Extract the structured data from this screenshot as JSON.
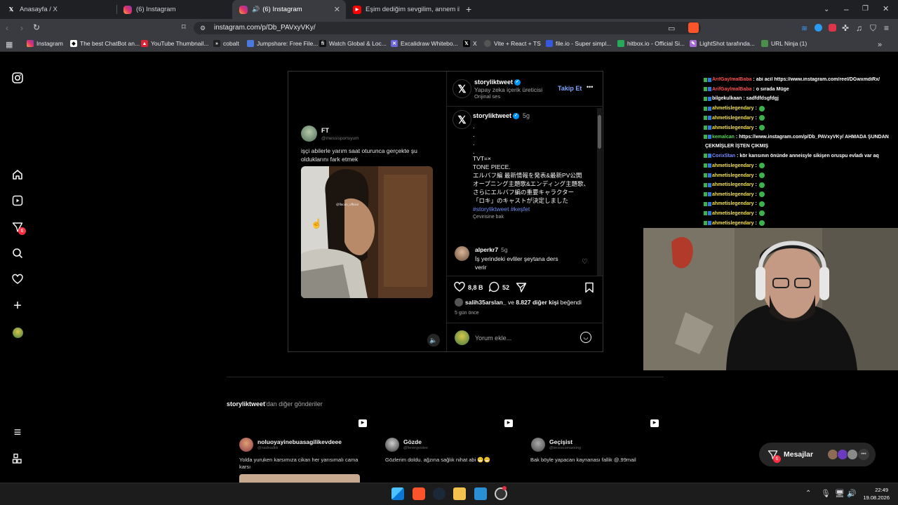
{
  "browser": {
    "tabs": [
      {
        "title": "Anasayfa / X",
        "icon": "x-logo-icon",
        "active": false
      },
      {
        "title": "(6) Instagram",
        "icon": "instagram-icon",
        "active": false
      },
      {
        "title": "(6) Instagram",
        "icon": "instagram-icon",
        "active": true
      },
      {
        "title": "Eşim dediğim sevgilim, annem ile ka...",
        "icon": "youtube-icon",
        "active": false
      }
    ],
    "url": "instagram.com/p/Db_PAVxyVKy/",
    "bookmarks": [
      "Instagram",
      "The best ChatBot an...",
      "YouTube Thumbnail...",
      "cobalt",
      "Jumpshare: Free File...",
      "Watch Global & Loc...",
      "Excalidraw Whitebo...",
      "X",
      "Vite + React + TS",
      "file.io - Super simpl...",
      "hitbox.io - Official Si...",
      "LightShot tarafında...",
      "URL Ninja (1)"
    ]
  },
  "sidebar": {
    "notification_count": "6"
  },
  "post": {
    "tweet": {
      "name": "FT",
      "handle": "@messisporluyum",
      "text": "işçi abilerle yarım saat oturunca gerçekte şu olduklarını fark etmek",
      "watermark": "@flacon_official"
    },
    "author": {
      "username": "storyliktweet",
      "subtitle": "Yapay zeka içerik üreticisi",
      "audio": "Orijinal ses",
      "follow_label": "Takip Et",
      "more": "•••"
    },
    "caption": {
      "username": "storyliktweet",
      "time": "5g",
      "dots": [
        ".",
        ".",
        ".",
        "."
      ],
      "lines": [
        "TVT=×",
        "TONE PIECE.",
        "エルバフ編 最新情報を発表&最新PV公開",
        "オープニング主題歌&エンディング主題歌、さらにエルバフ編の重要キャラクター",
        "「ロキ」のキャストが決定しました"
      ],
      "hashtags": "#storyliktweet #keşfet",
      "translate": "Çevirisine bak"
    },
    "comment": {
      "username": "alperkr7",
      "time": "5g",
      "text": "İş yerindeki evliler şeytana ders verir"
    },
    "actions": {
      "likes": "8,8 B",
      "comments": "52"
    },
    "liked_by": {
      "user": "salih35arslan_",
      "connector": "ve",
      "others": "8.827 diğer kişi",
      "suffix": "beğendi"
    },
    "time_ago": "5 gün önce",
    "comment_placeholder": "Yorum ekle..."
  },
  "chat_overlay": [
    {
      "user": "ArifGaylmalBaba",
      "msg": ": abi acil https://www.instagram.com/reel/DGwxmdiRx/",
      "color": "#ff4f4f"
    },
    {
      "user": "ArifGaylmalBaba",
      "msg": ": o sırada Müge",
      "color": "#ff4f4f"
    },
    {
      "user": "bilgekulkaan",
      "msg": ": sadfdfdsgfdgj",
      "color": "#ffffff"
    },
    {
      "user": "ahmetislegendary",
      "msg": ":",
      "color": "#f3e04a",
      "emote": true
    },
    {
      "user": "ahmetislegendary",
      "msg": ":",
      "color": "#f3e04a",
      "emote": true
    },
    {
      "user": "ahmetislegendary",
      "msg": ":",
      "color": "#f3e04a",
      "emote": true
    },
    {
      "user": "kemalcan",
      "msg": ": https://www.instagram.com/p/Db_PAVxyVKy/ AHMADA ŞUNDAN",
      "color": "#5ad45a"
    },
    {
      "user": "",
      "msg": "ÇEKMİŞLER İŞTEN ÇIKMIŞ",
      "color": "#ffffff"
    },
    {
      "user": "CorixStan",
      "msg": ": kör karısının önünde anneisyle sikişen oruspu evladı var aq",
      "color": "#7a8cff"
    },
    {
      "user": "ahmetislegendary",
      "msg": ":",
      "color": "#f3e04a",
      "emote": true
    },
    {
      "user": "ahmetislegendary",
      "msg": ":",
      "color": "#f3e04a",
      "emote": true
    },
    {
      "user": "ahmetislegendary",
      "msg": ":",
      "color": "#f3e04a",
      "emote": true
    },
    {
      "user": "ahmetislegendary",
      "msg": ":",
      "color": "#f3e04a",
      "emote": true
    },
    {
      "user": "ahmetislegendary",
      "msg": ":",
      "color": "#f3e04a",
      "emote": true
    },
    {
      "user": "ahmetislegendary",
      "msg": ":",
      "color": "#f3e04a",
      "emote": true
    },
    {
      "user": "ahmetislegendary",
      "msg": ":",
      "color": "#f3e04a",
      "emote": true
    }
  ],
  "more_posts": {
    "heading_user": "storyliktweet",
    "heading_suffix": "'dan diğer gönderiler",
    "cards": [
      {
        "name": "noluoyayinebuasagilikevdeee",
        "handle": "@nadnadkk",
        "text": "Yolda yuruken karsımıza cikan her yarısımalı cama karsı"
      },
      {
        "name": "Gözde",
        "handle": "@fenergotdee",
        "text": "Gözlerim doldu. ağzına sağlık nihat abi 😁😁"
      },
      {
        "name": "Geçişist",
        "handle": "@tecescomaxxing",
        "text": "Bak böyle yapacan kaynanası fallik @.99mail"
      }
    ]
  },
  "messages_button": {
    "label": "Mesajlar",
    "badge": "6"
  },
  "taskbar": {
    "time": "22:49",
    "date": "19.08.2026"
  },
  "colors": {
    "accent": "#0095f6",
    "follow": "#7fa6ff",
    "badge": "#ff3040"
  }
}
